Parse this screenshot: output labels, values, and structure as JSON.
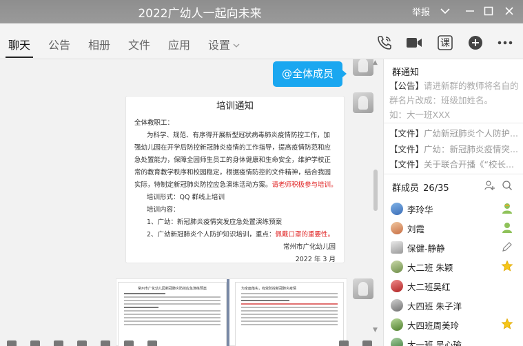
{
  "window": {
    "title": "2022广幼人一起向未来",
    "report_label": "举报"
  },
  "tabs": [
    {
      "label": "聊天",
      "active": true
    },
    {
      "label": "公告"
    },
    {
      "label": "相册"
    },
    {
      "label": "文件"
    },
    {
      "label": "应用"
    },
    {
      "label": "设置"
    }
  ],
  "toolbar": {
    "course_label": "课",
    "icons": [
      "phone-icon",
      "video-icon",
      "course-icon",
      "add-icon",
      "more-icon"
    ]
  },
  "chat": {
    "mention_bubble": "@全体成员",
    "doc": {
      "title": "培训通知",
      "lines": [
        "全体教职工：",
        "为科学、规范、有序得开展新型冠状病毒肺炎疫情防控工作，加",
        "强幼儿园在开学后防控新冠肺炎疫情的工作指导，提高疫情防范和应",
        "急处置能力，保障全园师生员工的身体健康和生命安全，维护学校正",
        "常的教育教学秩序和校园稳定，根据疫情防控的文件精神，结合我园",
        "实际，特制定新冠肺炎防控应急演练活动方案。",
        "培训形式：QQ 群线上培训",
        "培训内容：",
        "1、广幼：新冠肺炎疫情突发应急处置演练预案",
        "2、广幼新冠肺炎个人防护知识培训，重点："
      ],
      "red_line5": "请老师积极参与培训。",
      "red_line9": "佩戴口罩的重要性。",
      "signature": "常州市广化幼儿园",
      "date": "2022 年 3 月"
    },
    "thumb_left_title": "常州市广化幼儿园新冠肺炎防控应急演练预案",
    "thumb_right_title": "为全面落实，有效防控新冠肺炎疫情"
  },
  "notice": {
    "title": "群通知",
    "tag": "【公告】",
    "text": "请进新群的教师将名自的群名片改成：班级加姓名。",
    "example": "如：大一班XXX"
  },
  "files": [
    {
      "tag": "【文件】",
      "name": "广幼新冠肺炎个人防护..."
    },
    {
      "tag": "【文件】",
      "name": "广幼：新冠肺炎疫情突..."
    },
    {
      "tag": "【文件】",
      "name": "关于联合开播《“校长..."
    }
  ],
  "members": {
    "title": "群成员",
    "count": "26/35",
    "list": [
      {
        "name": "李玲华",
        "badge": "owner-icon"
      },
      {
        "name": "刘霞",
        "badge": "admin-icon"
      },
      {
        "name": "保健-静静",
        "badge": "edit-icon"
      },
      {
        "name": "大二班 朱颖",
        "badge": "star-icon"
      },
      {
        "name": "大二班吴红",
        "badge": ""
      },
      {
        "name": "大四班 朱子洋",
        "badge": ""
      },
      {
        "name": "大四班周美玲",
        "badge": "star-icon"
      },
      {
        "name": "大一班 吴心瑜",
        "badge": ""
      }
    ]
  },
  "colors": {
    "accent": "#1aa7f0",
    "title_bar": "#939393",
    "red_text": "#e02424",
    "owner_badge": "#8fc25a",
    "star_badge": "#f5c518"
  }
}
